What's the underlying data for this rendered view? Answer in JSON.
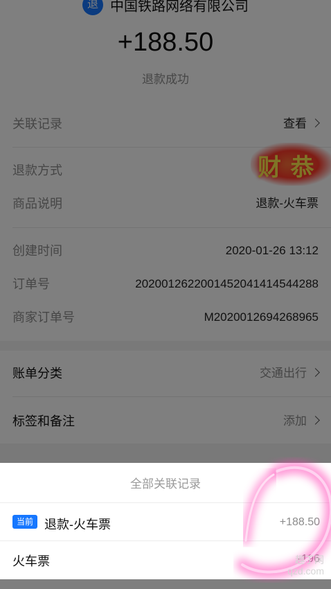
{
  "merchant": {
    "logo_char": "退",
    "name": "中国铁路网络有限公司"
  },
  "amount": "+188.50",
  "status": "退款成功",
  "details": {
    "related": {
      "label": "关联记录",
      "value": "查看"
    },
    "refund_method": {
      "label": "退款方式",
      "value": ""
    },
    "goods": {
      "label": "商品说明",
      "value": "退款-火车票"
    },
    "created": {
      "label": "创建时间",
      "value": "2020-01-26 13:12"
    },
    "order_no": {
      "label": "订单号",
      "value": "2020012622001452041414544288"
    },
    "merchant_order_no": {
      "label": "商家订单号",
      "value": "M2020012694268965"
    }
  },
  "category": {
    "label": "账单分类",
    "value": "交通出行"
  },
  "tags": {
    "label": "标签和备注",
    "value": "添加"
  },
  "stamp_text": "财 恭",
  "sheet": {
    "title": "全部关联记录",
    "rows": [
      {
        "badge": "当前",
        "label": "退款-火车票",
        "amount": "+188.50"
      },
      {
        "label": "火车票",
        "amount": "-196"
      }
    ]
  },
  "watermark": {
    "line1": "趣丁网",
    "line2": "qzd.com"
  },
  "colors": {
    "accent": "#1677ff",
    "annotation": "#ff3fb4"
  }
}
